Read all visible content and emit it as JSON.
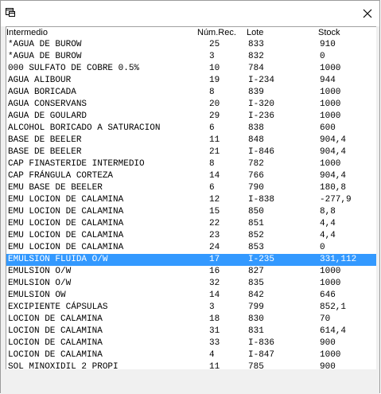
{
  "columns": {
    "intermedio": "Intermedio",
    "num_rec": "Núm.Rec.",
    "lote": "Lote",
    "stock": "Stock"
  },
  "selected_index": 18,
  "rows": [
    {
      "name": "*AGUA DE BUROW",
      "num": "25",
      "lote": "833",
      "stock": "910"
    },
    {
      "name": "*AGUA DE BUROW",
      "num": "3",
      "lote": "832",
      "stock": "0"
    },
    {
      "name": "000 SULFATO DE COBRE 0.5%",
      "num": "10",
      "lote": "784",
      "stock": "1000"
    },
    {
      "name": "AGUA ALIBOUR",
      "num": "19",
      "lote": "I-234",
      "stock": "944"
    },
    {
      "name": "AGUA BORICADA",
      "num": "8",
      "lote": "839",
      "stock": "1000"
    },
    {
      "name": "AGUA CONSERVANS",
      "num": "20",
      "lote": "I-320",
      "stock": "1000"
    },
    {
      "name": "AGUA DE GOULARD",
      "num": "29",
      "lote": "I-236",
      "stock": "1000"
    },
    {
      "name": "ALCOHOL BORICADO A SATURACION",
      "num": "6",
      "lote": "838",
      "stock": "600"
    },
    {
      "name": "BASE DE BEELER",
      "num": "11",
      "lote": "848",
      "stock": "904,4"
    },
    {
      "name": "BASE DE BEELER",
      "num": "21",
      "lote": "I-846",
      "stock": "904,4"
    },
    {
      "name": "CAP FINASTERIDE INTERMEDIO",
      "num": "8",
      "lote": "782",
      "stock": "1000"
    },
    {
      "name": "CAP FRÁNGULA CORTEZA",
      "num": "14",
      "lote": "766",
      "stock": "904,4"
    },
    {
      "name": "EMU BASE DE BEELER",
      "num": "6",
      "lote": "790",
      "stock": "180,8"
    },
    {
      "name": "EMU LOCION DE CALAMINA",
      "num": "12",
      "lote": "I-838",
      "stock": "-277,9"
    },
    {
      "name": "EMU LOCION DE CALAMINA",
      "num": "15",
      "lote": "850",
      "stock": "8,8"
    },
    {
      "name": "EMU LOCION DE CALAMINA",
      "num": "22",
      "lote": "851",
      "stock": "4,4"
    },
    {
      "name": "EMU LOCION DE CALAMINA",
      "num": "23",
      "lote": "852",
      "stock": "4,4"
    },
    {
      "name": "EMU LOCION DE CALAMINA",
      "num": "24",
      "lote": "853",
      "stock": "0"
    },
    {
      "name": "EMULSION FLUIDA O/W",
      "num": "17",
      "lote": "I-235",
      "stock": "331,112"
    },
    {
      "name": "EMULSION O/W",
      "num": "16",
      "lote": "827",
      "stock": "1000"
    },
    {
      "name": "EMULSION O/W",
      "num": "32",
      "lote": "835",
      "stock": "1000"
    },
    {
      "name": "EMULSION OW",
      "num": "14",
      "lote": "842",
      "stock": "646"
    },
    {
      "name": "EXCIPIENTE CÁPSULAS",
      "num": "3",
      "lote": "799",
      "stock": "852,1"
    },
    {
      "name": "LOCION DE CALAMINA",
      "num": "18",
      "lote": "830",
      "stock": "70"
    },
    {
      "name": "LOCION DE CALAMINA",
      "num": "31",
      "lote": "831",
      "stock": "614,4"
    },
    {
      "name": "LOCION DE CALAMINA",
      "num": "33",
      "lote": "I-836",
      "stock": "900"
    },
    {
      "name": "LOCION DE CALAMINA",
      "num": "4",
      "lote": "I-847",
      "stock": "1000"
    },
    {
      "name": "SOL MINOXIDIL 2 PROPI",
      "num": "11",
      "lote": "785",
      "stock": "900"
    }
  ]
}
